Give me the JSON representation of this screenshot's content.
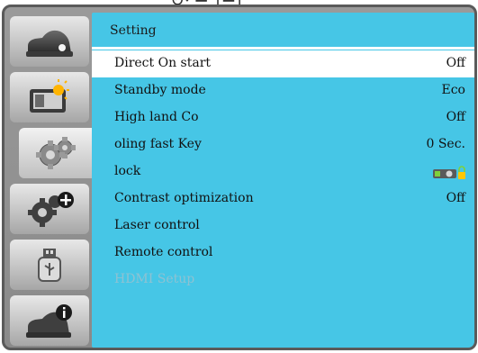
{
  "top_marks": "↻· ━ │━│",
  "sidebar": {
    "tabs": [
      {
        "name": "sidebar-tab-image",
        "icon": "image-adjust-icon"
      },
      {
        "name": "sidebar-tab-display",
        "icon": "display-icon"
      },
      {
        "name": "sidebar-tab-setting",
        "icon": "setting-gears-icon",
        "active": true
      },
      {
        "name": "sidebar-tab-extended",
        "icon": "extended-settings-icon"
      },
      {
        "name": "sidebar-tab-usb",
        "icon": "usb-icon"
      },
      {
        "name": "sidebar-tab-info",
        "icon": "info-icon"
      }
    ]
  },
  "panel": {
    "title": "Setting",
    "rows": [
      {
        "label": "Direct On start",
        "value": "Off",
        "selected": true
      },
      {
        "label": "Standby mode",
        "value": "Eco"
      },
      {
        "label": "High land  Co",
        "value": "Off"
      },
      {
        "label": "oling fast  Key",
        "value": "0 Sec."
      },
      {
        "label": "lock",
        "value": "",
        "value_icon": "projector-lock-icon"
      },
      {
        "label": "Contrast optimization",
        "value": "Off"
      },
      {
        "label": "Laser control",
        "value": ""
      },
      {
        "label": "Remote control",
        "value": ""
      },
      {
        "label": "HDMI Setup",
        "value": "",
        "disabled": true
      }
    ]
  },
  "colors": {
    "panel_bg": "#46c6e6",
    "selected_row_bg": "#ffffff",
    "disabled_text": "#8ec2d2",
    "frame_bg": "#8e8e8e"
  }
}
